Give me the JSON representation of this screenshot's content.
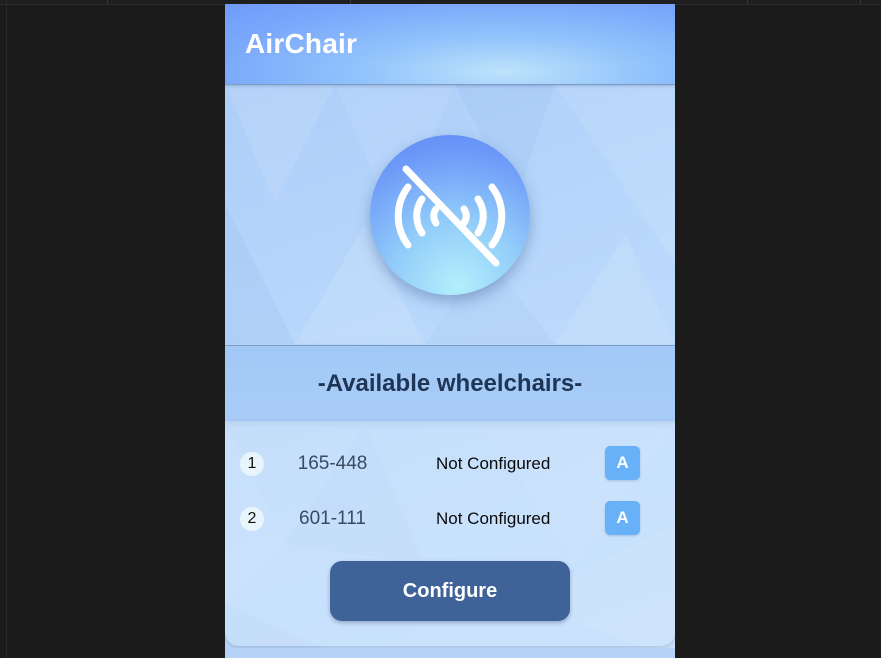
{
  "app": {
    "title": "AirChair"
  },
  "status": {
    "icon": "signal-off-icon",
    "connected": false
  },
  "section": {
    "heading": "-Available wheelchairs-"
  },
  "wheelchairs": [
    {
      "index": "1",
      "code": "165-448",
      "status": "Not Configured",
      "action_label": "A"
    },
    {
      "index": "2",
      "code": "601-111",
      "status": "Not Configured",
      "action_label": "A"
    }
  ],
  "actions": {
    "configure_label": "Configure"
  },
  "colors": {
    "header_gradient_start": "#6f9cfa",
    "header_gradient_end": "#bde2fb",
    "configure_button": "#3f6298",
    "row_action_button": "#68b0f7",
    "heading_text": "#1e3556"
  }
}
